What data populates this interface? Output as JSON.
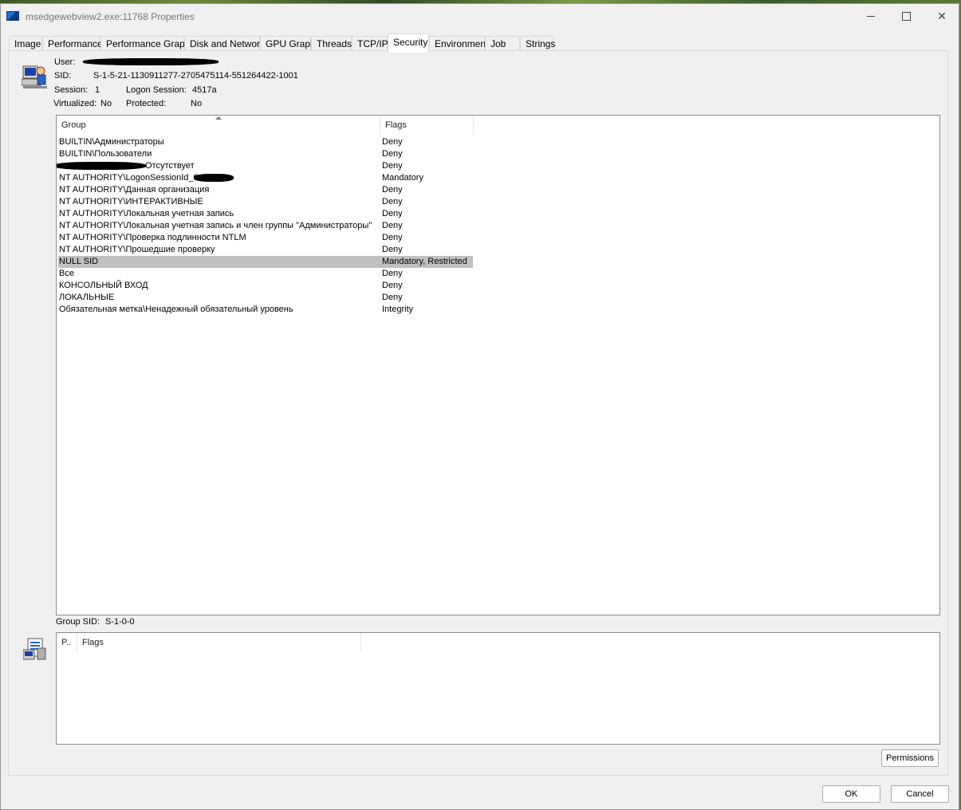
{
  "window": {
    "title": "msedgewebview2.exe:11768 Properties"
  },
  "tabs": [
    {
      "label": "Image"
    },
    {
      "label": "Performance"
    },
    {
      "label": "Performance Graph"
    },
    {
      "label": "Disk and Network"
    },
    {
      "label": "GPU Graph"
    },
    {
      "label": "Threads"
    },
    {
      "label": "TCP/IP"
    },
    {
      "label": "Security"
    },
    {
      "label": "Environment"
    },
    {
      "label": "Job"
    },
    {
      "label": "Strings"
    }
  ],
  "active_tab": "Security",
  "info": {
    "user_label": "User:",
    "sid_label": "SID:",
    "sid_value": "S-1-5-21-1130911277-2705475114-551264422-1001",
    "session_label": "Session:",
    "session_value": "1",
    "logon_label": "Logon Session:",
    "logon_value": "4517a",
    "virtualized_label": "Virtualized:",
    "virtualized_value": "No",
    "protected_label": "Protected:",
    "protected_value": "No"
  },
  "groups": {
    "col_group": "Group",
    "col_flags": "Flags",
    "rows": [
      {
        "group": "BUILTIN\\Администраторы",
        "flags": "Deny"
      },
      {
        "group": "BUILTIN\\Пользователи",
        "flags": "Deny"
      },
      {
        "group": "Отсутствует",
        "flags": "Deny"
      },
      {
        "group": "NT AUTHORITY\\LogonSessionId_0",
        "flags": "Mandatory"
      },
      {
        "group": "NT AUTHORITY\\Данная организация",
        "flags": "Deny"
      },
      {
        "group": "NT AUTHORITY\\ИНТЕРАКТИВНЫЕ",
        "flags": "Deny"
      },
      {
        "group": "NT AUTHORITY\\Локальная учетная запись",
        "flags": "Deny"
      },
      {
        "group": "NT AUTHORITY\\Локальная учетная запись и член группы \"Администраторы\"",
        "flags": "Deny"
      },
      {
        "group": "NT AUTHORITY\\Проверка подлинности NTLM",
        "flags": "Deny"
      },
      {
        "group": "NT AUTHORITY\\Прошедшие проверку",
        "flags": "Deny"
      },
      {
        "group": "NULL SID",
        "flags": "Mandatory, Restricted",
        "selected": true
      },
      {
        "group": "Все",
        "flags": "Deny"
      },
      {
        "group": "КОНСОЛЬНЫЙ ВХОД",
        "flags": "Deny"
      },
      {
        "group": "ЛОКАЛЬНЫЕ",
        "flags": "Deny"
      },
      {
        "group": "Обязательная метка\\Ненадежный обязательный уровень",
        "flags": "Integrity"
      }
    ]
  },
  "group_sid": {
    "label": "Group SID:",
    "value": "S-1-0-0"
  },
  "privileges": {
    "col_priv": "P..",
    "col_flags": "Flags"
  },
  "buttons": {
    "permissions": "Permissions",
    "ok": "OK",
    "cancel": "Cancel"
  }
}
